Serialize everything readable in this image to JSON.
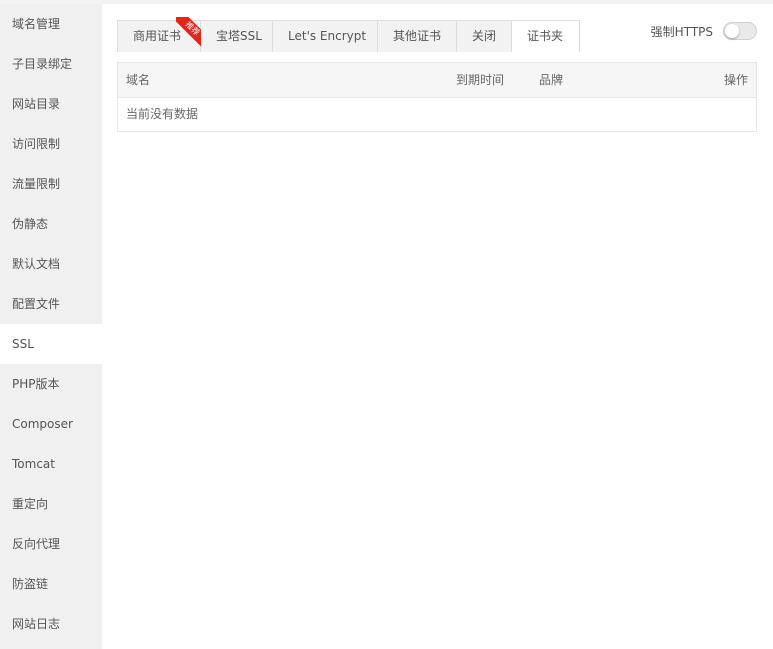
{
  "sidebar": {
    "items": [
      {
        "label": "域名管理"
      },
      {
        "label": "子目录绑定"
      },
      {
        "label": "网站目录"
      },
      {
        "label": "访问限制"
      },
      {
        "label": "流量限制"
      },
      {
        "label": "伪静态"
      },
      {
        "label": "默认文档"
      },
      {
        "label": "配置文件"
      },
      {
        "label": "SSL"
      },
      {
        "label": "PHP版本"
      },
      {
        "label": "Composer"
      },
      {
        "label": "Tomcat"
      },
      {
        "label": "重定向"
      },
      {
        "label": "反向代理"
      },
      {
        "label": "防盗链"
      },
      {
        "label": "网站日志"
      }
    ],
    "active_index": 8
  },
  "tabs": {
    "items": [
      {
        "label": "商用证书",
        "badge": "推荐"
      },
      {
        "label": "宝塔SSL"
      },
      {
        "label": "Let's Encrypt"
      },
      {
        "label": "其他证书"
      },
      {
        "label": "关闭"
      },
      {
        "label": "证书夹"
      }
    ],
    "active_index": 5
  },
  "force_https": {
    "label": "强制HTTPS",
    "enabled": false
  },
  "table": {
    "columns": [
      "域名",
      "到期时间",
      "品牌",
      "操作"
    ],
    "empty_text": "当前没有数据"
  },
  "colors": {
    "sidebar_bg": "#f0f0f0",
    "ribbon": "#e0251b",
    "tab_bg": "#f2f2f2"
  }
}
